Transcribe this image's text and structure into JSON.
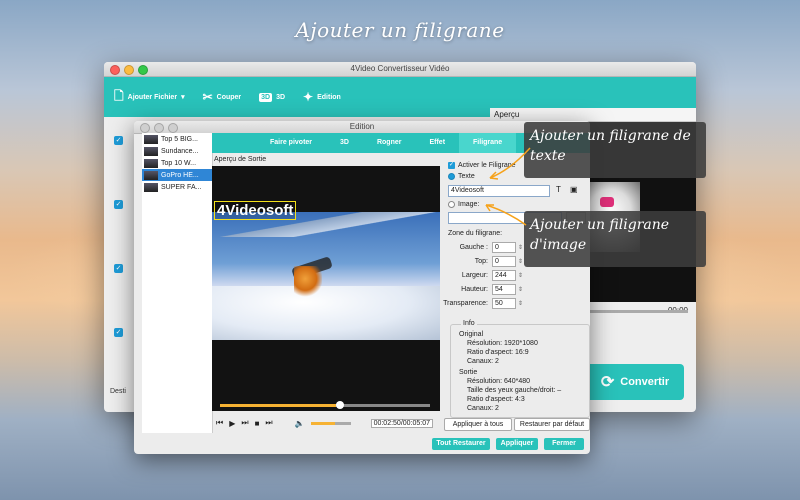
{
  "banner": "Ajouter un filigrane",
  "main_window": {
    "title": "4Video Convertisseur Vidéo",
    "toolbar": {
      "add_file": "Ajouter Fichier",
      "cut": "Couper",
      "three_d_badge": "3D",
      "three_d": "3D",
      "edit": "Edition"
    },
    "destination_label": "Desti",
    "preview_label": "Aperçu",
    "preview_time": "00:00",
    "convert_label": "Convertir"
  },
  "dialog": {
    "title": "Edition",
    "files": [
      {
        "name": "Top 5 BIG..."
      },
      {
        "name": "Sundance..."
      },
      {
        "name": "Top 10 W..."
      },
      {
        "name": "GoPro HE..."
      },
      {
        "name": "SUPER FA..."
      }
    ],
    "tabs": [
      "Faire pivoter",
      "3D",
      "Rogner",
      "Effet",
      "Filigrane"
    ],
    "active_tab": "Filigrane",
    "output_preview_label": "Aperçu de Sortie",
    "watermark_text_shown": "4Videosoft",
    "time_current": "00:02:50",
    "time_total": "00:05:07",
    "time_display": "00:02:50/00:05:07",
    "enable_watermark": "Activer le Filigrane",
    "text_option": "Texte",
    "text_value": "4Videosoft",
    "image_option": "Image:",
    "zone_label": "Zone du filigrane:",
    "fields": [
      {
        "label": "Gauche :",
        "value": "0"
      },
      {
        "label": "Top:",
        "value": "0"
      },
      {
        "label": "Largeur:",
        "value": "244"
      },
      {
        "label": "Hauteur:",
        "value": "54"
      },
      {
        "label": "Transparence:",
        "value": "50"
      }
    ],
    "info": {
      "legend": "Info",
      "original_label": "Original",
      "orig_resolution": "Résolution: 1920*1080",
      "orig_ratio": "Ratio d'aspect: 16:9",
      "orig_channels": "Canaux: 2",
      "output_label": "Sortie",
      "out_resolution": "Résolution: 640*480",
      "out_eyes": "Taille des yeux gauche/droit: –",
      "out_ratio": "Ratio d'aspect: 4:3",
      "out_channels": "Canaux: 2"
    },
    "apply_all": "Appliquer à tous",
    "restore_default": "Restaurer par défaut",
    "restore_all": "Tout Restaurer",
    "apply": "Appliquer",
    "close": "Fermer"
  },
  "callouts": {
    "text_watermark": "Ajouter un filigrane de texte",
    "image_watermark": "Ajouter un filigrane d'image"
  },
  "colors": {
    "accent": "#29c2ba",
    "select_blue": "#2f86d6",
    "slider_orange": "#f6b233"
  }
}
